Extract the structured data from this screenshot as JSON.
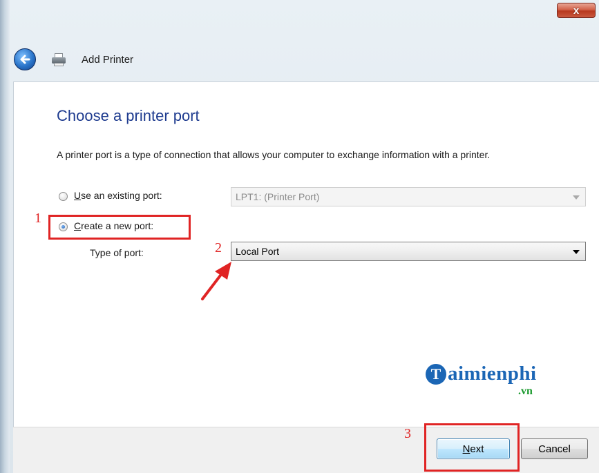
{
  "window": {
    "close_glyph": "x",
    "title": "Add Printer"
  },
  "icons": {
    "back": "back-arrow-icon",
    "printer": "printer-icon"
  },
  "main": {
    "heading": "Choose a printer port",
    "description": "A printer port is a type of connection that allows your computer to exchange information with a printer.",
    "existing_port": {
      "label_first": "U",
      "label_rest": "se an existing port:",
      "selected": false,
      "value": "LPT1: (Printer Port)"
    },
    "new_port": {
      "label_first": "C",
      "label_rest": "reate a new port:",
      "selected": true
    },
    "port_type": {
      "label": "Type of port:",
      "value": "Local Port"
    }
  },
  "annotations": {
    "step1": "1",
    "step2": "2",
    "step3": "3",
    "color": "#e02424"
  },
  "watermark": {
    "initial": "T",
    "name": "aimienphi",
    "suffix": ".vn"
  },
  "footer": {
    "next_first": "N",
    "next_rest": "ext",
    "cancel": "Cancel"
  }
}
